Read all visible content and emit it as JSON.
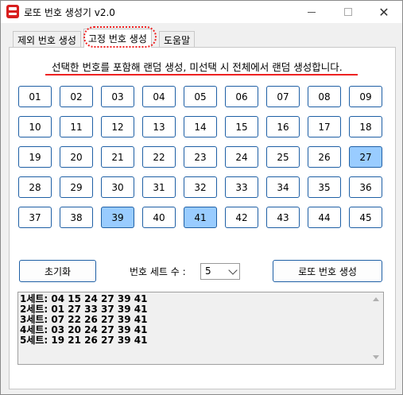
{
  "window": {
    "title": "로또 번호 생성기 v2.0",
    "close_glyph": "✕"
  },
  "tabs": [
    {
      "label": "제외 번호 생성",
      "active": false
    },
    {
      "label": "고정 번호 생성",
      "active": true
    },
    {
      "label": "도움말",
      "active": false
    }
  ],
  "instruction": "선택한 번호를 포함해 랜덤 생성, 미선택 시 전체에서 랜덤 생성합니다.",
  "numbers": [
    "01",
    "02",
    "03",
    "04",
    "05",
    "06",
    "07",
    "08",
    "09",
    "10",
    "11",
    "12",
    "13",
    "14",
    "15",
    "16",
    "17",
    "18",
    "19",
    "20",
    "21",
    "22",
    "23",
    "24",
    "25",
    "26",
    "27",
    "28",
    "29",
    "30",
    "31",
    "32",
    "33",
    "34",
    "35",
    "36",
    "37",
    "38",
    "39",
    "40",
    "41",
    "42",
    "43",
    "44",
    "45"
  ],
  "selected_numbers": [
    "27",
    "39",
    "41"
  ],
  "controls": {
    "reset_label": "초기화",
    "set_count_label": "번호 세트 수 :",
    "set_count_value": "5",
    "generate_label": "로또 번호 생성"
  },
  "results": [
    "1세트: 04 15 24 27 39 41",
    "2세트: 01 27 33 37 39 41",
    "3세트: 07 22 26 27 39 41",
    "4세트: 03 20 24 27 39 41",
    "5세트: 19 21 26 27 39 41"
  ],
  "colors": {
    "selected_fill": "#99ccff",
    "button_border": "#1e5fa5",
    "annotation_red": "#e22222"
  }
}
